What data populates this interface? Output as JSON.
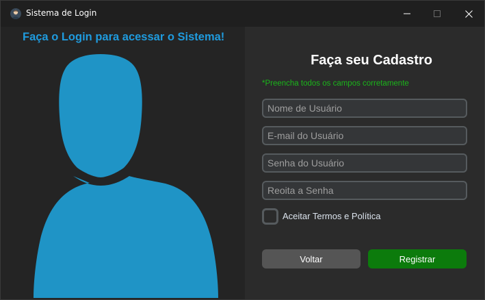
{
  "window": {
    "title": "Sistema de Login"
  },
  "left": {
    "heading": "Faça o Login para acessar o Sistema!",
    "accent_color": "#1f9bde",
    "image_icon": "user-silhouette-icon"
  },
  "form": {
    "heading": "Faça seu Cadastro",
    "hint": "*Preencha todos os campos corretamente",
    "hint_color": "#1bb51b",
    "fields": {
      "username": {
        "placeholder": "Nome de Usuário",
        "value": ""
      },
      "email": {
        "placeholder": "E-mail do Usuário",
        "value": ""
      },
      "password": {
        "placeholder": "Senha do Usuário",
        "value": ""
      },
      "confirm": {
        "placeholder": "Reoita a Senha",
        "value": ""
      }
    },
    "terms_label": "Aceitar Termos e Política",
    "terms_checked": false,
    "back_label": "Voltar",
    "register_label": "Registrar",
    "register_color": "#0c7b0c"
  }
}
